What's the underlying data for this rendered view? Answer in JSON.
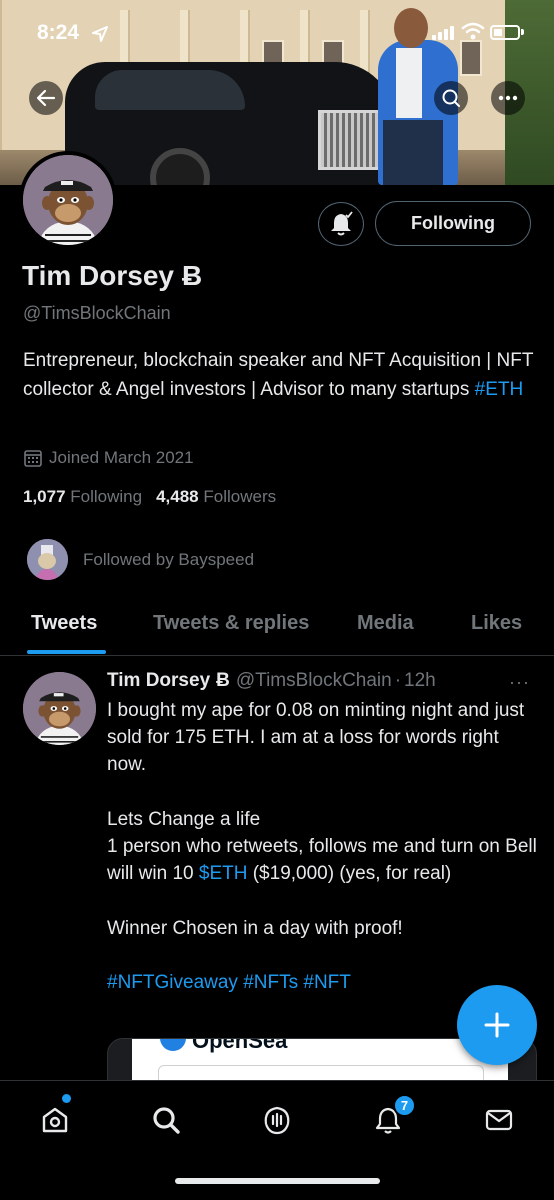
{
  "status_bar": {
    "time": "8:24"
  },
  "profile": {
    "name": "Tim Dorsey",
    "name_symbol": "Ƀ",
    "handle": "@TimsBlockChain",
    "bio_text": "Entrepreneur, blockchain speaker and NFT Acquisition | NFT collector & Angel investors | Advisor to many startups ",
    "bio_hashtag": "#ETH",
    "joined": "Joined March 2021",
    "following_count": "1,077",
    "following_label": "Following",
    "followers_count": "4,488",
    "followers_label": "Followers",
    "followed_by": "Followed by Bayspeed",
    "following_button": "Following"
  },
  "tabs": [
    {
      "label": "Tweets",
      "active": true
    },
    {
      "label": "Tweets & replies",
      "active": false
    },
    {
      "label": "Media",
      "active": false
    },
    {
      "label": "Likes",
      "active": false
    }
  ],
  "tweet": {
    "name": "Tim Dorsey",
    "name_symbol": "Ƀ",
    "handle": "@TimsBlockChain",
    "separator": "·",
    "time": "12h",
    "more": "···",
    "line1": "I bought my ape for 0.08 on minting night and just sold for 175 ETH. I am at a loss for words right now.",
    "line2": "Lets Change a life",
    "line3_pre": "1 person who retweets, follows me and turn on Bell will win 10 ",
    "line3_link": "$ETH",
    "line3_post": " ($19,000) (yes, for real)",
    "line4": "Winner Chosen in a day with proof!",
    "hashtags": "#NFTGiveaway #NFTs #NFT",
    "card_title": "OpenSea"
  },
  "nav": {
    "items": [
      "home-icon",
      "search-icon",
      "spaces-icon",
      "notifications-icon",
      "messages-icon"
    ],
    "notification_count": "7"
  },
  "colors": {
    "accent": "#1d9bf0",
    "background": "#000000",
    "secondary_text": "#71767b"
  }
}
